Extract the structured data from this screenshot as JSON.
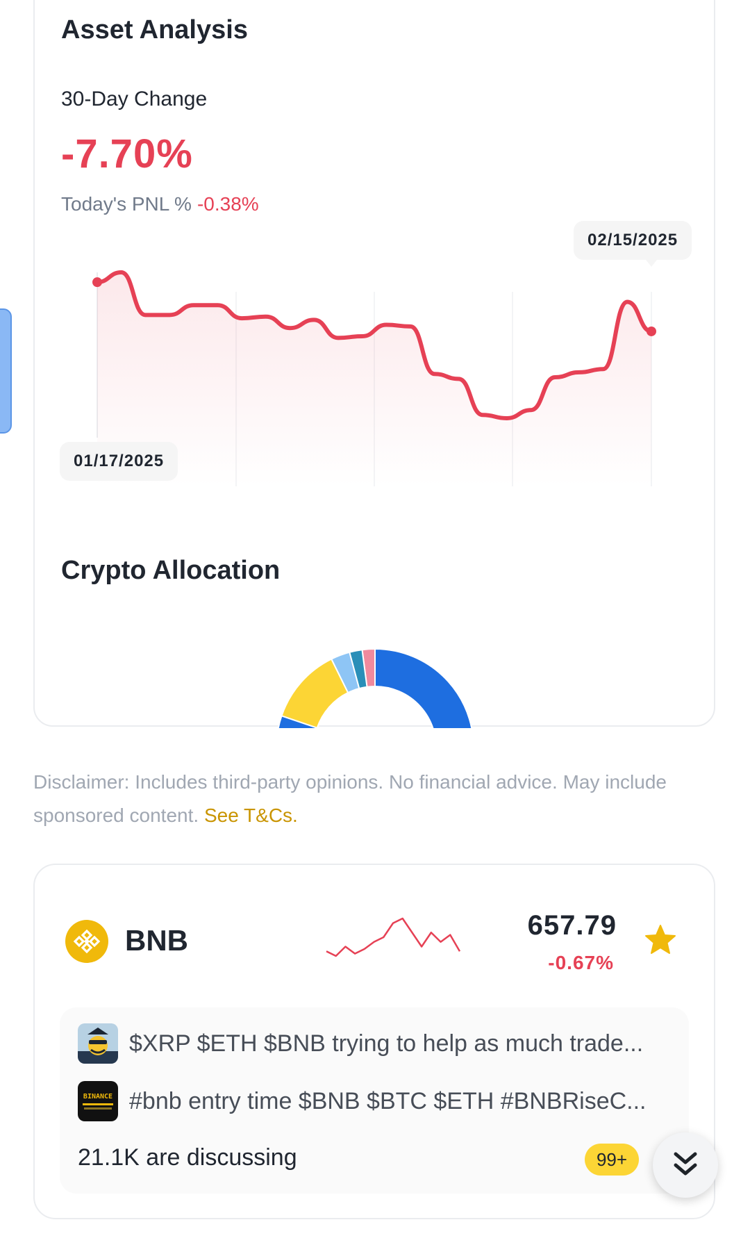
{
  "asset_analysis": {
    "title": "Asset Analysis",
    "change_label": "30-Day Change",
    "change_value": "-7.70%",
    "pnl_label": "Today's PNL %",
    "pnl_value": "-0.38%",
    "start_date": "01/17/2025",
    "end_date": "02/15/2025"
  },
  "chart_data": {
    "type": "line",
    "title": "",
    "xlabel": "",
    "ylabel": "",
    "x_range": [
      "01/17/2025",
      "02/15/2025"
    ],
    "series": [
      {
        "values": [
          0.0,
          0.6,
          -2.0,
          -2.0,
          -1.4,
          -1.4,
          -2.2,
          -2.1,
          -2.8,
          -2.3,
          -3.4,
          -3.3,
          -2.6,
          -2.7,
          -5.6,
          -5.9,
          -8.1,
          -8.3,
          -7.8,
          -5.8,
          -5.5,
          -5.3,
          -1.2,
          -3.0
        ]
      }
    ],
    "color": "#e64155",
    "grid": false
  },
  "allocation": {
    "title": "Crypto Allocation",
    "slices": [
      {
        "share": 77,
        "color": "#1e6ee0"
      },
      {
        "share": 12,
        "color": "#fcd535"
      },
      {
        "share": 3,
        "color": "#8ec5f5"
      },
      {
        "share": 2,
        "color": "#2a8fb8"
      },
      {
        "share": 2,
        "color": "#f08a9d"
      }
    ]
  },
  "disclaimer": {
    "text": "Disclaimer: Includes third-party opinions. No financial advice. May include sponsored content.",
    "link": "See T&Cs."
  },
  "coin": {
    "symbol": "BNB",
    "price": "657.79",
    "change": "-0.67%",
    "icon": "bnb-icon",
    "favorited": true,
    "spark": [
      3,
      2,
      4,
      2.5,
      3.5,
      5,
      6,
      9,
      10,
      7,
      4,
      7,
      5,
      6.5,
      3
    ]
  },
  "discussion": {
    "posts": [
      {
        "text": "$XRP $ETH $BNB trying to help as much trade..."
      },
      {
        "text": "#bnb entry time $BNB $BTC $ETH #BNBRiseC...",
        "avatar_text": "BINANCE"
      }
    ],
    "count_text": "21.1K are discussing",
    "badge": "99+"
  },
  "colors": {
    "negative": "#e64155",
    "brand_yellow": "#f0b90b",
    "link": "#c99400"
  }
}
